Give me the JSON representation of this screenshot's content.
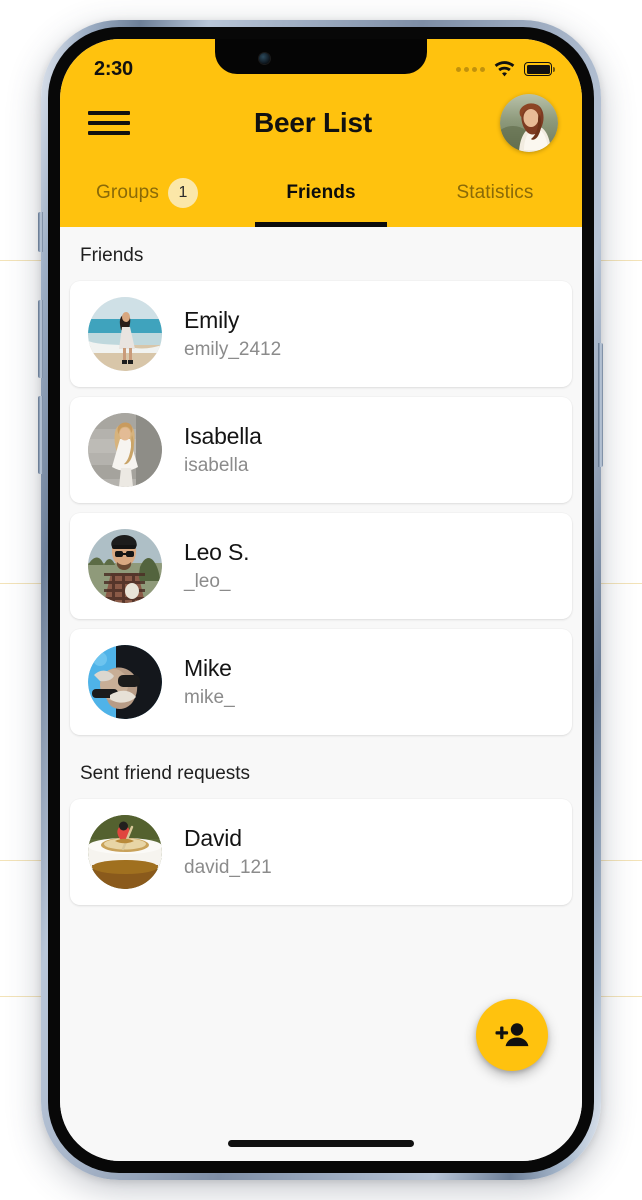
{
  "theme": {
    "brand_yellow": "#FFC20E",
    "badge_yellow": "#FBE7A8",
    "screen_bg": "#F8F8F8",
    "card_bg": "#FFFFFF",
    "text_primary": "#141414",
    "text_muted": "#8B8B8B",
    "tab_inactive": "#8A6A08"
  },
  "status_bar": {
    "time": "2:30",
    "signal_icon": "signal-dots-icon",
    "wifi_icon": "wifi-icon",
    "battery_icon": "battery-full-icon",
    "battery_level": 100
  },
  "app_bar": {
    "menu_icon": "hamburger-menu-icon",
    "title": "Beer List",
    "avatar_icon": "user-avatar"
  },
  "tabs": [
    {
      "label": "Groups",
      "active": false,
      "badge": "1"
    },
    {
      "label": "Friends",
      "active": true,
      "badge": null
    },
    {
      "label": "Statistics",
      "active": false,
      "badge": null
    }
  ],
  "sections": [
    {
      "title": "Friends",
      "items": [
        {
          "name": "Emily",
          "handle": "emily_2412"
        },
        {
          "name": "Isabella",
          "handle": "isabella"
        },
        {
          "name": "Leo S.",
          "handle": "_leo_"
        },
        {
          "name": "Mike",
          "handle": "mike_"
        }
      ]
    },
    {
      "title": "Sent friend requests",
      "items": [
        {
          "name": "David",
          "handle": "david_121"
        }
      ]
    }
  ],
  "fab": {
    "icon": "person-add-icon",
    "label": "Add friend"
  },
  "home_indicator": "home-indicator-bar"
}
